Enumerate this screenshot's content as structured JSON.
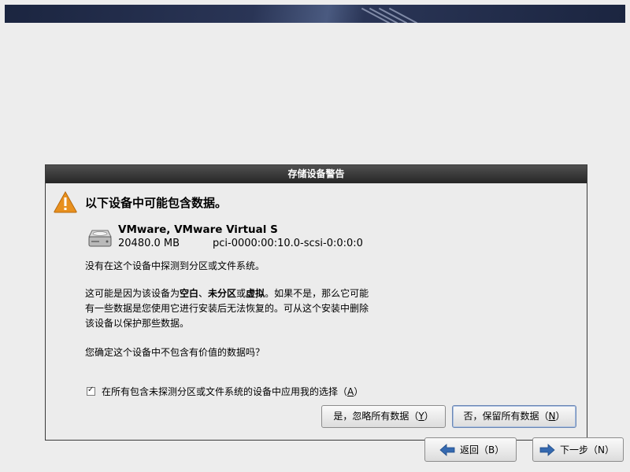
{
  "dialog": {
    "title": "存储设备警告",
    "heading": "以下设备中可能包含数据。",
    "device": {
      "name": "VMware, VMware Virtual S",
      "size": "20480.0 MB",
      "path": "pci-0000:00:10.0-scsi-0:0:0:0"
    },
    "message1": "没有在这个设备中探测到分区或文件系统。",
    "message2": {
      "part1": "这可能是因为该设备为",
      "bold1": "空白",
      "sep1": "、",
      "bold2": "未分区",
      "sep2": "或",
      "bold3": "虚拟",
      "part2": "。如果不是，那么它可能",
      "line2": "有一些数据是您使用它进行安装后无法恢复的。可从这个安装中删除",
      "line3": "该设备以保护那些数据。"
    },
    "question": "您确定这个设备中不包含有价值的数据吗？",
    "checkbox": {
      "label": "在所有包含未探测分区或文件系统的设备中应用我的选择（",
      "mnemonic": "A",
      "suffix": "）",
      "checked": true
    },
    "yes_button": {
      "label": "是，忽略所有数据（",
      "mnemonic": "Y",
      "suffix": "）"
    },
    "no_button": {
      "label": "否，保留所有数据（",
      "mnemonic": "N",
      "suffix": "）"
    }
  },
  "nav": {
    "back_label": "返回（B）",
    "next_label": "下一步（N）"
  },
  "colors": {
    "warning": "#e8901e",
    "titlebar": "#2e2e2e",
    "arrow": "#3569b0"
  },
  "icons": {
    "warning": "warning-triangle-icon",
    "disk": "hard-disk-icon",
    "back": "arrow-left-icon",
    "next": "arrow-right-icon"
  }
}
